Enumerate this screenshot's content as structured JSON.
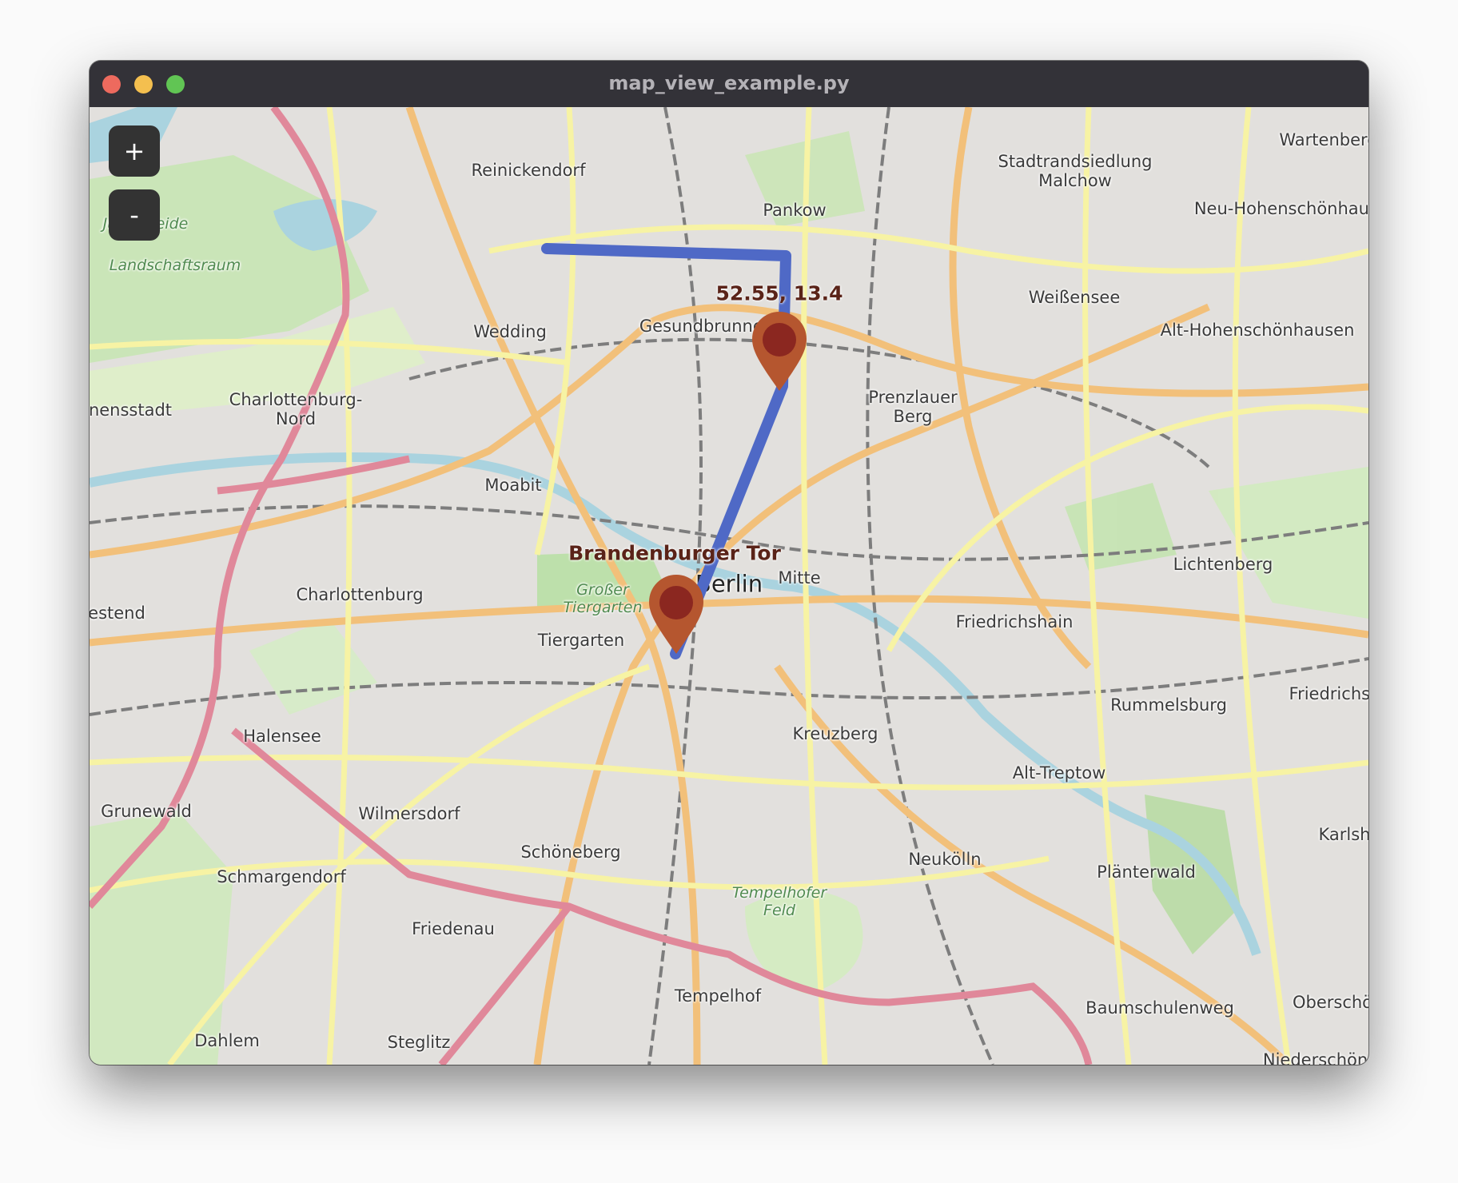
{
  "window": {
    "title": "map_view_example.py",
    "traffic_lights": {
      "close": "#ed6a5e",
      "minimize": "#f4bf4f",
      "maximize": "#61c554"
    }
  },
  "controls": {
    "zoom_in_label": "+",
    "zoom_out_label": "-"
  },
  "route": {
    "color": "#4f69c6"
  },
  "markers": [
    {
      "label": "52.55, 13.4",
      "color": "#b5562f",
      "inner": "#8b2720"
    },
    {
      "label": "Brandenburger Tor",
      "color": "#b5562f",
      "inner": "#8b2720"
    }
  ],
  "map_labels": {
    "reinickendorf": "Reinickendorf",
    "pankow": "Pankow",
    "malchow": "Stadtrandsiedlung\nMalchow",
    "wartenberg": "Wartenberg",
    "neu_hohenschoenhausen": "Neu-Hohenschönhausen",
    "weissensee": "Weißensee",
    "alt_hohenschoenhausen": "Alt-Hohenschönhausen",
    "wedding": "Wedding",
    "gesundbrunnen": "Gesundbrunnen",
    "prenzlauer_berg": "Prenzlauer\nBerg",
    "charlottenburg_nord": "Charlottenburg-\nNord",
    "siemensstadt": "nensstadt",
    "moabit": "Moabit",
    "berlin": "Berlin",
    "mitte": "Mitte",
    "lichtenberg": "Lichtenberg",
    "charlottenburg": "Charlottenburg",
    "grosser_tiergarten": "Großer\nTiergarten",
    "tiergarten": "Tiergarten",
    "friedrichshain": "Friedrichshain",
    "westend": "estend",
    "friedrichsfelde": "Friedrichsf",
    "rummelsburg": "Rummelsburg",
    "halensee": "Halensee",
    "kreuzberg": "Kreuzberg",
    "alt_treptow": "Alt-Treptow",
    "grunewald": "Grunewald",
    "wilmersdorf": "Wilmersdorf",
    "karlshorst": "Karlsh",
    "schoeneberg": "Schöneberg",
    "neukoelln": "Neukölln",
    "plaenterwald": "Plänterwald",
    "schmargendorf": "Schmargendorf",
    "tempelhofer_feld": "Tempelhofer\nFeld",
    "friedenau": "Friedenau",
    "tempelhof": "Tempelhof",
    "baumschulenweg": "Baumschulenweg",
    "oberschoeneweide": "Oberschö",
    "dahlem": "Dahlem",
    "steglitz": "Steglitz",
    "niederschoeneweide": "Niederschöne",
    "landschaftsraum": "Landschaftsraum",
    "jungfernheide": "Ju      heide"
  }
}
